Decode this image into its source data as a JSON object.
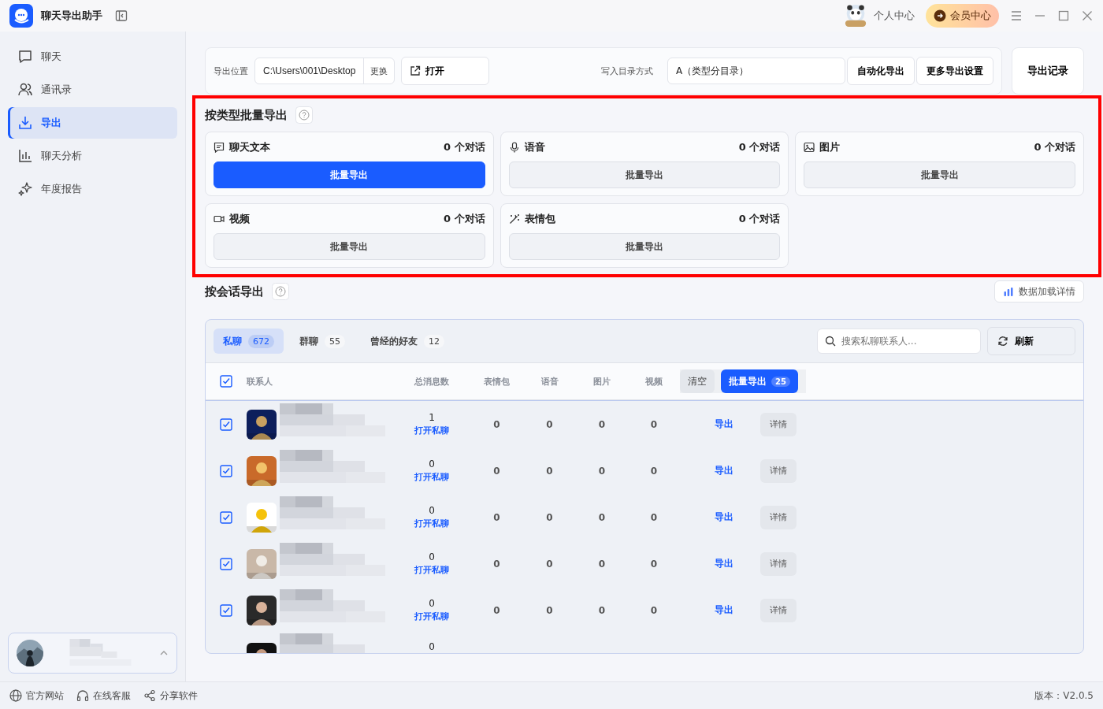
{
  "app": {
    "title": "聊天导出助手"
  },
  "titlebar": {
    "personal": "个人中心",
    "vip": "会员中心"
  },
  "sidebar": {
    "items": [
      {
        "label": "聊天",
        "selected": false
      },
      {
        "label": "通讯录",
        "selected": false
      },
      {
        "label": "导出",
        "selected": true
      },
      {
        "label": "聊天分析",
        "selected": false
      },
      {
        "label": "年度报告",
        "selected": false
      }
    ]
  },
  "export_bar": {
    "location_label": "导出位置",
    "path": "C:\\Users\\001\\Desktop",
    "change": "更换",
    "open": "打开",
    "dir_label": "写入目录方式",
    "dir_value": "A（类型分目录）",
    "auto": "自动化导出",
    "more": "更多导出设置",
    "records": "导出记录"
  },
  "batch_section": {
    "title": "按类型批量导出",
    "cards": [
      {
        "label": "聊天文本",
        "count": "0 个对话",
        "button": "批量导出",
        "primary": true
      },
      {
        "label": "语音",
        "count": "0 个对话",
        "button": "批量导出",
        "primary": false
      },
      {
        "label": "图片",
        "count": "0 个对话",
        "button": "批量导出",
        "primary": false
      },
      {
        "label": "视频",
        "count": "0 个对话",
        "button": "批量导出",
        "primary": false
      },
      {
        "label": "表情包",
        "count": "0 个对话",
        "button": "批量导出",
        "primary": false
      }
    ]
  },
  "session_section": {
    "title": "按会话导出",
    "load_details": "数据加载详情",
    "tabs": [
      {
        "label": "私聊",
        "count": "672",
        "selected": true
      },
      {
        "label": "群聊",
        "count": "55",
        "selected": false
      },
      {
        "label": "曾经的好友",
        "count": "12",
        "selected": false
      }
    ],
    "search_placeholder": "搜索私聊联系人...",
    "refresh": "刷新",
    "header_checked": true,
    "columns": [
      "联系人",
      "总消息数",
      "表情包",
      "语音",
      "图片",
      "视频"
    ],
    "clear": "清空",
    "batch_export": "批量导出",
    "batch_count": "25",
    "rows": [
      {
        "checked": true,
        "total": "1",
        "open": "打开私聊",
        "emoji": "0",
        "voice": "0",
        "image": "0",
        "video": "0",
        "export": "导出",
        "detail": "详情"
      },
      {
        "checked": true,
        "total": "0",
        "open": "打开私聊",
        "emoji": "0",
        "voice": "0",
        "image": "0",
        "video": "0",
        "export": "导出",
        "detail": "详情"
      },
      {
        "checked": true,
        "total": "0",
        "open": "打开私聊",
        "emoji": "0",
        "voice": "0",
        "image": "0",
        "video": "0",
        "export": "导出",
        "detail": "详情"
      },
      {
        "checked": true,
        "total": "0",
        "open": "打开私聊",
        "emoji": "0",
        "voice": "0",
        "image": "0",
        "video": "0",
        "export": "导出",
        "detail": "详情"
      },
      {
        "checked": true,
        "total": "0",
        "open": "打开私聊",
        "emoji": "0",
        "voice": "0",
        "image": "0",
        "video": "0",
        "export": "导出",
        "detail": "详情"
      },
      {
        "total": "0"
      }
    ]
  },
  "footer": {
    "links": [
      "官方网站",
      "在线客服",
      "分享软件"
    ],
    "version": "版本：V2.0.5"
  }
}
